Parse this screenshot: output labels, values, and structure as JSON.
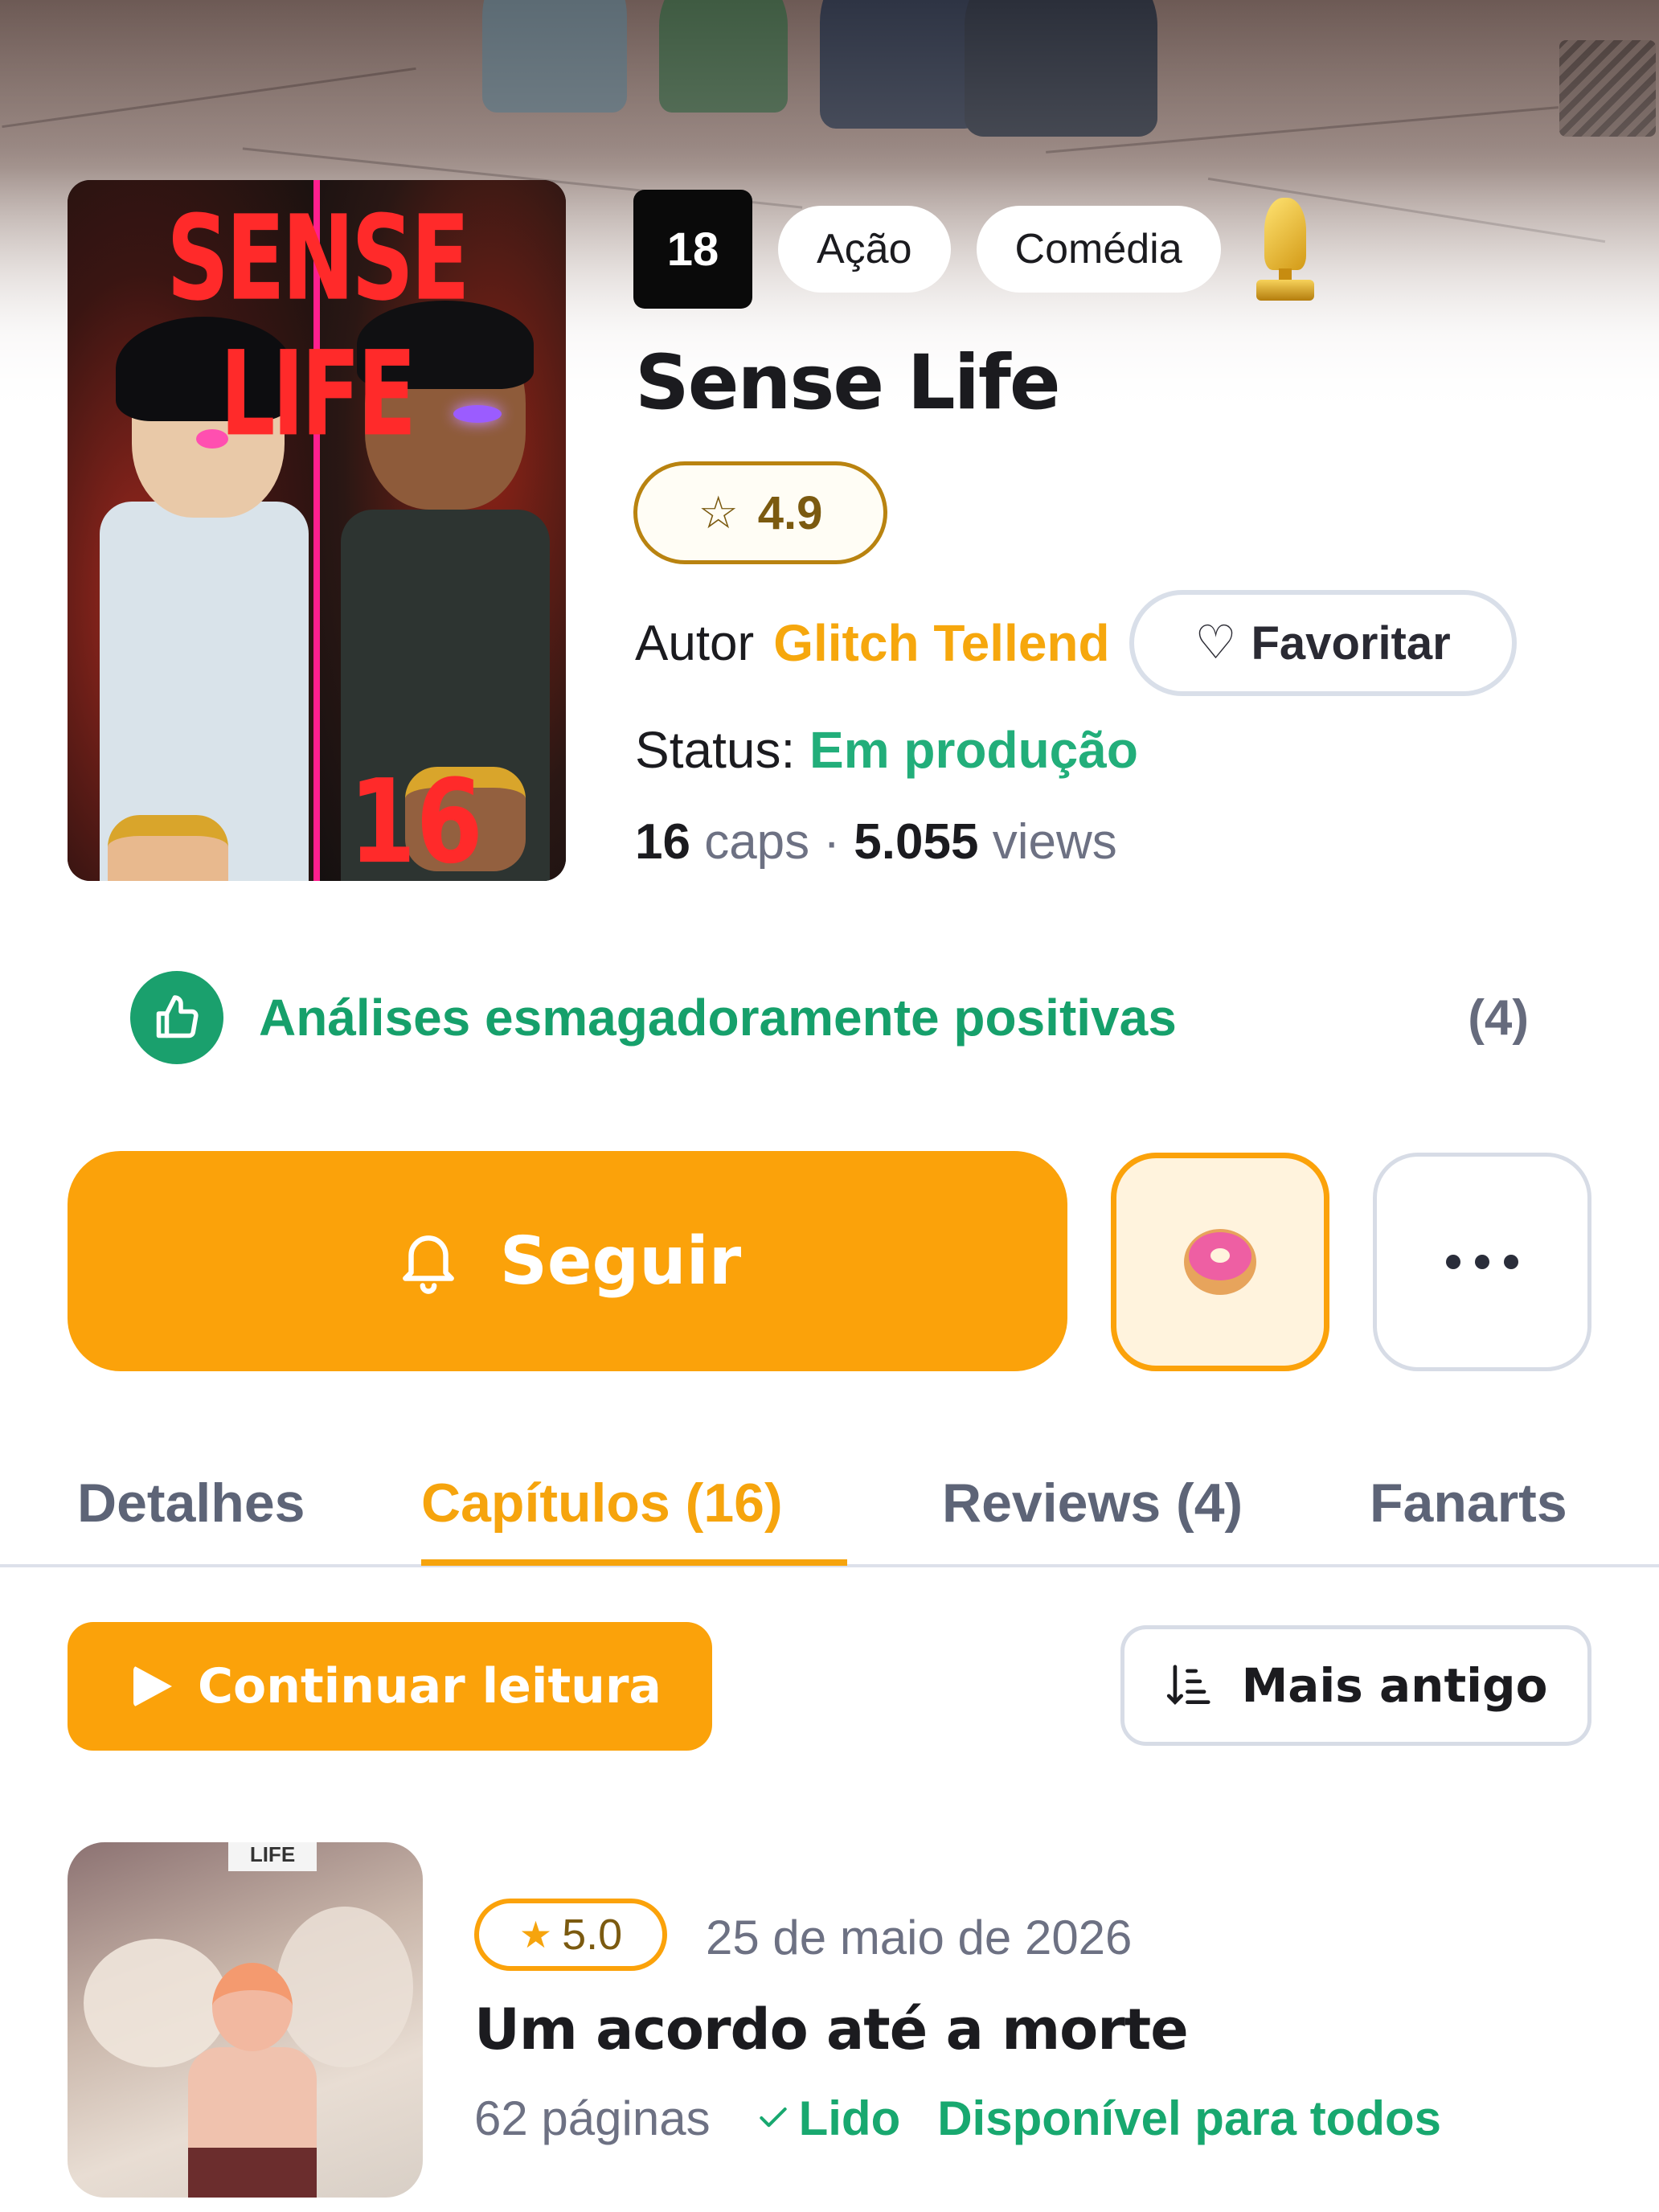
{
  "manga": {
    "age_rating": "18",
    "genres": [
      "Ação",
      "Comédia"
    ],
    "title": "Sense Life",
    "cover_title": "SENSE LIFE",
    "cover_volume": "16",
    "rating": "4.9",
    "author_label": "Autor",
    "author_name": "Glitch Tellend",
    "favorite_label": "Favoritar",
    "status_label": "Status:",
    "status_value": "Em produção",
    "chapters_count": "16",
    "chapters_unit": "caps",
    "separator": "·",
    "views_count": "5.055",
    "views_unit": "views"
  },
  "reviews_summary": {
    "text": "Análises esmagadoramente positivas",
    "count": "(4)"
  },
  "actions": {
    "follow_label": "Seguir",
    "donate_icon": "donut-icon",
    "more_icon": "more-dots-icon"
  },
  "tabs": [
    {
      "label": "Detalhes",
      "active": false
    },
    {
      "label": "Capítulos (16)",
      "active": true
    },
    {
      "label": "Reviews (4)",
      "active": false
    },
    {
      "label": "Fanarts",
      "active": false
    }
  ],
  "chapter_toolbar": {
    "continue_label": "Continuar leitura",
    "sort_label": "Mais antigo"
  },
  "chapters": [
    {
      "rating": "5.0",
      "date": "25 de maio de 2026",
      "title": "Um acordo até a morte",
      "pages": "62 páginas",
      "read_label": "Lido",
      "availability": "Disponível para todos",
      "thumb_sign": "LIFE"
    }
  ],
  "colors": {
    "accent": "#fba20a",
    "positive": "#16a06b",
    "muted": "#6d7183"
  }
}
